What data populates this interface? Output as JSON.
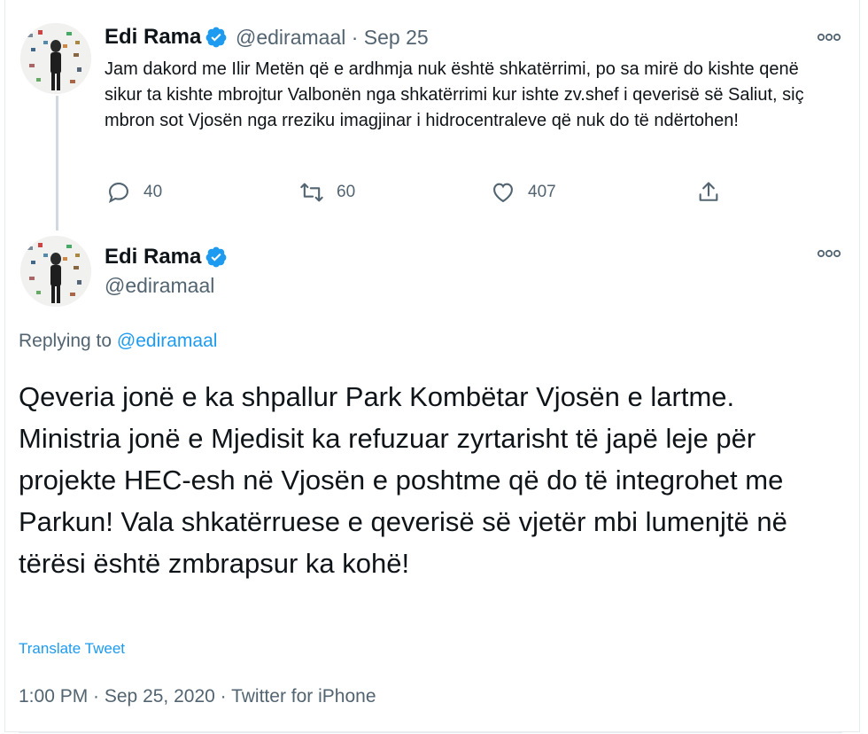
{
  "colors": {
    "accent": "#1d9bf0",
    "text": "#0f1419",
    "secondary": "#536471",
    "border": "#e6ecf0"
  },
  "tweet1": {
    "author_name": "Edi Rama",
    "handle": "@ediramaal",
    "separator": "·",
    "date": "Sep 25",
    "text": "Jam dakord me Ilir Metën që e ardhmja nuk është shkatërrimi, po sa mirë do kishte qenë sikur ta kishte mbrojtur Valbonën nga shkatërrimi kur ishte zv.shef i qeverisë së Saliut, siç mbron sot Vjosën nga rreziku imagjinar i hidrocentraleve që nuk do të ndërtohen!",
    "replies": "40",
    "retweets": "60",
    "likes": "407",
    "icons": {
      "reply": "reply-icon",
      "retweet": "retweet-icon",
      "like": "heart-icon",
      "share": "share-icon",
      "more": "more-icon",
      "verified": "verified-badge-icon"
    }
  },
  "tweet2": {
    "author_name": "Edi Rama",
    "handle": "@ediramaal",
    "replying_prefix": "Replying to",
    "replying_handle": "@ediramaal",
    "text": "Qeveria jonë e ka shpallur Park Kombëtar Vjosën e lartme. Ministria jonë e Mjedisit ka refuzuar zyrtarisht të japë leje për projekte HEC-esh në Vjosën e poshtme që do të integrohet me Parkun! Vala shkatërruese e qeverisë së vjetër mbi lumenjtë në tërësi është zmbrapsur ka kohë!",
    "translate_label": "Translate Tweet",
    "meta": "1:00 PM · Sep 25, 2020 · Twitter for iPhone"
  }
}
